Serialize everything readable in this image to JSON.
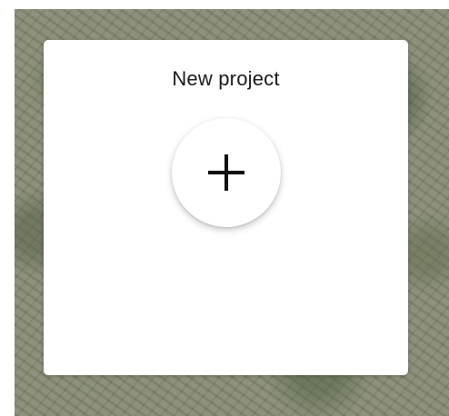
{
  "card": {
    "title": "New project"
  },
  "add_button": {
    "icon": "plus-icon"
  },
  "colors": {
    "card_background": "#ffffff",
    "icon_color": "#111111"
  }
}
